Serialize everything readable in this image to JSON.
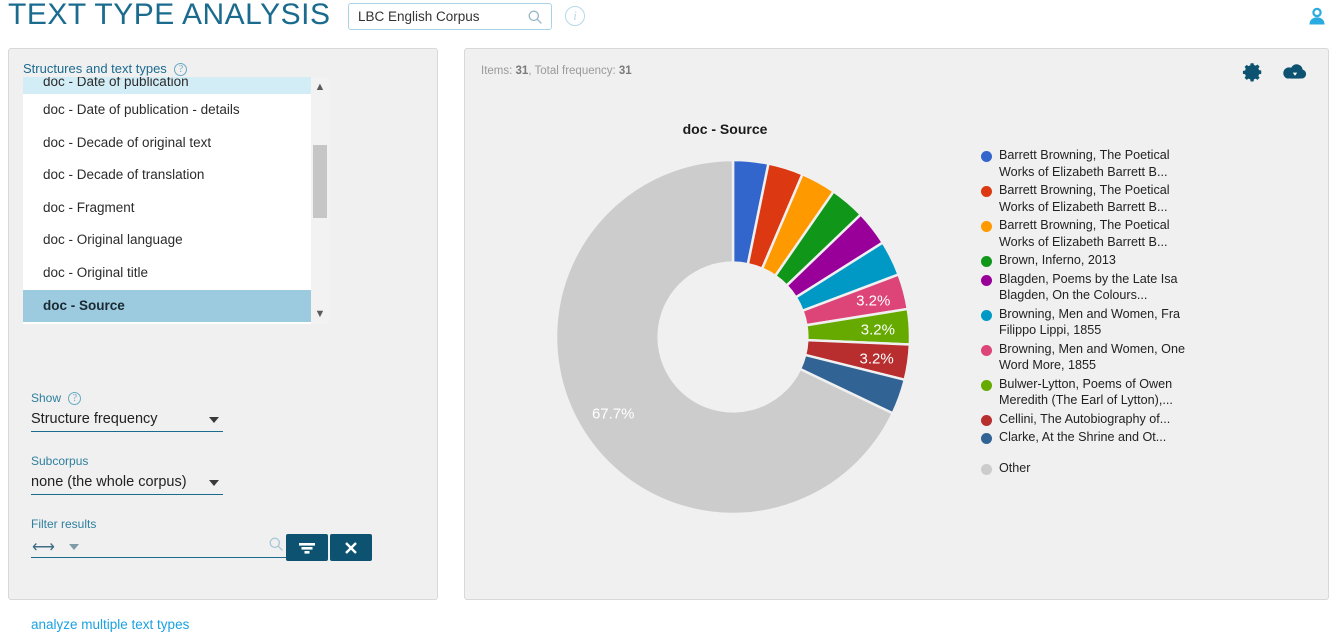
{
  "header": {
    "title": "TEXT TYPE ANALYSIS",
    "corpus_value": "LBC English Corpus",
    "search_icon": "search-icon",
    "info_icon": "info-icon",
    "user_icon": "user-account-icon"
  },
  "sidebar": {
    "structures_label": "Structures and text types",
    "help_icon": "help-icon",
    "items": [
      {
        "label": "doc - Date of publication",
        "state": "partial"
      },
      {
        "label": "doc - Date of publication - details",
        "state": "normal"
      },
      {
        "label": "doc - Decade of original text",
        "state": "normal"
      },
      {
        "label": "doc - Decade of translation",
        "state": "normal"
      },
      {
        "label": "doc - Fragment",
        "state": "normal"
      },
      {
        "label": "doc - Original language",
        "state": "normal"
      },
      {
        "label": "doc - Original title",
        "state": "normal"
      },
      {
        "label": "doc - Source",
        "state": "selected"
      }
    ],
    "show": {
      "label": "Show",
      "value": "Structure frequency"
    },
    "subcorpus": {
      "label": "Subcorpus",
      "value": "none (the whole corpus)"
    },
    "filter": {
      "label": "Filter results",
      "value": "",
      "placeholder": "",
      "apply_icon": "funnel-filter-icon",
      "clear_icon": "close-x-icon"
    },
    "multi_link": "analyze multiple text types"
  },
  "results": {
    "items_prefix": "Items:",
    "items_count": "31",
    "freq_prefix": "Total frequency:",
    "freq_count": "31",
    "settings_icon": "gear-icon",
    "download_icon": "cloud-download-icon"
  },
  "chart_data": {
    "type": "pie",
    "title": "doc - Source",
    "xlabel": "",
    "ylabel": "",
    "donut_hole": 0.42,
    "start_angle": 0,
    "legend_position": "right",
    "total_frequency": 31,
    "items": 31,
    "categories": [
      "Barrett Browning, The Poetical Works of Elizabeth Barrett B...",
      "Barrett Browning, The Poetical Works of Elizabeth Barrett B...",
      "Barrett Browning, The Poetical Works of Elizabeth Barrett B...",
      "Brown, Inferno, 2013",
      "Blagden, Poems by the Late Isa Blagden, On the Colours...",
      "Browning, Men and Women, Fra Filippo Lippi, 1855",
      "Browning, Men and Women, One Word More, 1855",
      "Bulwer-Lytton, Poems of Owen Meredith (The Earl of Lytton),...",
      "Cellini, The Autobiography of...",
      "Clarke, At the Shrine and Ot...",
      "Other"
    ],
    "values": [
      3.2,
      3.2,
      3.2,
      3.2,
      3.2,
      3.2,
      3.2,
      3.2,
      3.2,
      3.2,
      67.7
    ],
    "counts": [
      1,
      1,
      1,
      1,
      1,
      1,
      1,
      1,
      1,
      1,
      21
    ],
    "colors": [
      "#3366cc",
      "#dc3912",
      "#ff9900",
      "#109618",
      "#990099",
      "#0099c6",
      "#dd4477",
      "#66aa00",
      "#b82e2e",
      "#316395",
      "#cccccc"
    ],
    "shown_labels": [
      {
        "index": 6,
        "text": "3.2%"
      },
      {
        "index": 7,
        "text": "3.2%"
      },
      {
        "index": 8,
        "text": "3.2%"
      },
      {
        "index": 10,
        "text": "67.7%"
      }
    ],
    "legend_entries": [
      {
        "color": "#3366cc",
        "line1": "Barrett Browning, The Poetical",
        "line2": "Works of Elizabeth Barrett B..."
      },
      {
        "color": "#dc3912",
        "line1": "Barrett Browning, The Poetical",
        "line2": "Works of Elizabeth Barrett B..."
      },
      {
        "color": "#ff9900",
        "line1": "Barrett Browning, The Poetical",
        "line2": "Works of Elizabeth Barrett B..."
      },
      {
        "color": "#109618",
        "line1": "Brown, Inferno, 2013",
        "line2": ""
      },
      {
        "color": "#990099",
        "line1": "Blagden, Poems by the Late",
        "line2": "Isa Blagden, On the Colours..."
      },
      {
        "color": "#0099c6",
        "line1": "Browning, Men and Women,",
        "line2": "Fra Filippo Lippi, 1855"
      },
      {
        "color": "#dd4477",
        "line1": "Browning, Men and Women,",
        "line2": "One Word More, 1855"
      },
      {
        "color": "#66aa00",
        "line1": "Bulwer-Lytton, Poems of Owen",
        "line2": "Meredith (The Earl of Lytton),..."
      },
      {
        "color": "#b82e2e",
        "line1": "Cellini, The Autobiography of...",
        "line2": ""
      },
      {
        "color": "#316395",
        "line1": "Clarke, At the Shrine and Ot...",
        "line2": ""
      }
    ],
    "legend_other": {
      "color": "#cccccc",
      "label": "Other"
    }
  },
  "colors": {
    "accent": "#1b6b8f",
    "link": "#1ba1e2",
    "button": "#0d5371",
    "panel_bg": "#f0f0f0",
    "selected_row": "#9ccbdf"
  }
}
